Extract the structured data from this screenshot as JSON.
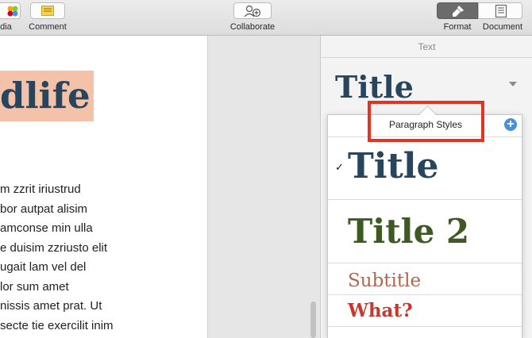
{
  "toolbar": {
    "media_label": "edia",
    "comment_label": "Comment",
    "collaborate_label": "Collaborate",
    "format_label": "Format",
    "document_label": "Document"
  },
  "document": {
    "title": "dlife",
    "lines": [
      "m zzrit iriustrud",
      "bor autpat alisim",
      "amconse min ulla",
      "e duisim zzriusto elit",
      "ugait lam vel del",
      "lor sum amet",
      "nissis amet prat. Ut",
      "secte tie exercilit inim"
    ]
  },
  "inspector": {
    "header": "Text",
    "current_style": "Title"
  },
  "paragraph_styles": {
    "title": "Paragraph Styles",
    "add_symbol": "+",
    "checkmark": "✓",
    "items": [
      {
        "label": "Title",
        "color": "#27465d"
      },
      {
        "label": "Title 2",
        "color": "#3d5a22"
      },
      {
        "label": "Subtitle",
        "color": "#b16450"
      },
      {
        "label": "What?",
        "color": "#c8362c"
      }
    ]
  },
  "colors": {
    "highlight": "#e6321e",
    "title_bg": "#f4c2a9"
  }
}
